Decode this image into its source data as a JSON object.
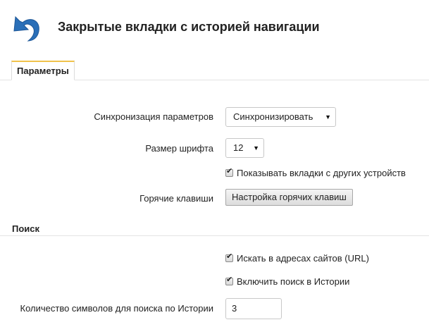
{
  "header": {
    "title": "Закрытые вкладки с историей навигации",
    "logo_icon": "undo-arrow-icon",
    "logo_color": "#2a6fb8"
  },
  "tabs": [
    {
      "label": "Параметры",
      "active": true
    }
  ],
  "settings": {
    "sync": {
      "label": "Синхронизация параметров",
      "value": "Синхронизировать"
    },
    "font_size": {
      "label": "Размер шрифта",
      "value": "12"
    },
    "show_other_devices": {
      "label": "Показывать вкладки с других устройств",
      "checked": true
    },
    "hotkeys": {
      "label": "Горячие клавиши",
      "button_label": "Настройка горячих клавиш"
    }
  },
  "search": {
    "section_title": "Поиск",
    "search_urls": {
      "label": "Искать в адресах сайтов (URL)",
      "checked": true
    },
    "search_history": {
      "label": "Включить поиск в Истории",
      "checked": true
    },
    "min_chars": {
      "label": "Количество символов для поиска по Истории",
      "value": "3"
    }
  },
  "colors": {
    "accent_tab": "#f0c24b",
    "divider": "#e3e3e3"
  }
}
